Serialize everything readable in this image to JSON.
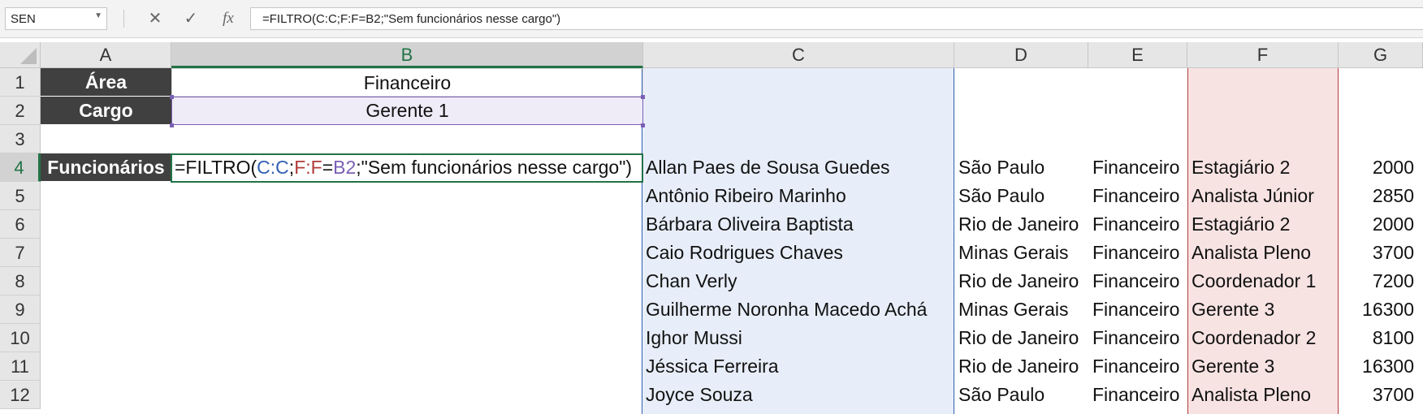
{
  "name_box": "SEN",
  "formula_bar": {
    "cancel_symbol": "✕",
    "enter_symbol": "✓",
    "fx_label": "fx",
    "formula": "=FILTRO(C:C;F:F=B2;\"Sem funcionários nesse cargo\")"
  },
  "columns": [
    "A",
    "B",
    "C",
    "D",
    "E",
    "F",
    "G"
  ],
  "rows": [
    "1",
    "2",
    "3",
    "4",
    "5",
    "6",
    "7",
    "8",
    "9",
    "10",
    "11",
    "12"
  ],
  "selected_column": "B",
  "selected_row": "4",
  "cells": {
    "A1": "Área",
    "B1": "Financeiro",
    "A2": "Cargo",
    "B2": "Gerente 1",
    "A4": "Funcionários"
  },
  "edit_formula": {
    "prefix": "=FILTRO(",
    "ref1": "C:C",
    "sep1": ";",
    "ref2": "F:F",
    "eq": "=",
    "ref3": "B2",
    "suffix": ";\"Sem funcionários nesse cargo\")"
  },
  "table": [
    {
      "name": "Allan Paes de Sousa Guedes",
      "state": "São Paulo",
      "area": "Financeiro",
      "role": "Estagiário 2",
      "salary": "2000"
    },
    {
      "name": "Antônio Ribeiro Marinho",
      "state": "São Paulo",
      "area": "Financeiro",
      "role": "Analista Júnior",
      "salary": "2850"
    },
    {
      "name": "Bárbara Oliveira Baptista",
      "state": "Rio de Janeiro",
      "area": "Financeiro",
      "role": "Estagiário 2",
      "salary": "2000"
    },
    {
      "name": "Caio Rodrigues Chaves",
      "state": "Minas Gerais",
      "area": "Financeiro",
      "role": "Analista Pleno",
      "salary": "3700"
    },
    {
      "name": "Chan Verly",
      "state": "Rio de Janeiro",
      "area": "Financeiro",
      "role": "Coordenador 1",
      "salary": "7200"
    },
    {
      "name": "Guilherme Noronha Macedo Achá",
      "state": "Minas Gerais",
      "area": "Financeiro",
      "role": "Gerente 3",
      "salary": "16300"
    },
    {
      "name": "Ighor Mussi",
      "state": "Rio de Janeiro",
      "area": "Financeiro",
      "role": "Coordenador 2",
      "salary": "8100"
    },
    {
      "name": "Jéssica Ferreira",
      "state": "Rio de Janeiro",
      "area": "Financeiro",
      "role": "Gerente 3",
      "salary": "16300"
    },
    {
      "name": "Joyce Souza",
      "state": "São Paulo",
      "area": "Financeiro",
      "role": "Analista Pleno",
      "salary": "3700"
    }
  ],
  "colors": {
    "accent_green": "#217346",
    "ref_blue": "#2f5fb3",
    "ref_red": "#b03a3a",
    "ref_purple": "#7a5fb5",
    "header_fill": "#404040"
  }
}
